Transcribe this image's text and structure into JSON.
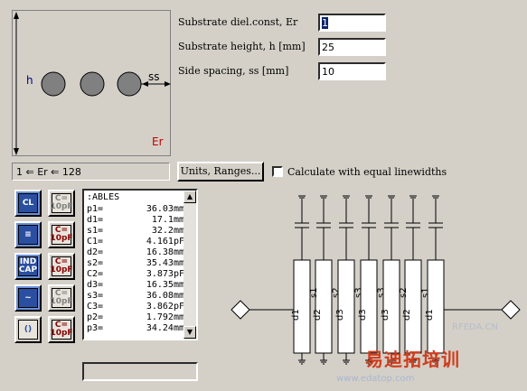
{
  "diagram": {
    "height_label": "h",
    "spacing_label": "ss",
    "er_label": "Er"
  },
  "params": [
    {
      "label": "Substrate diel.const, Er",
      "value": "1"
    },
    {
      "label": "Substrate height, h [mm]",
      "value": "25"
    },
    {
      "label": "Side spacing, ss [mm]",
      "value": "10"
    }
  ],
  "range_text": "1 ⇐ Er ⇐ 128",
  "units_button": "Units, Ranges...",
  "equal_linewidths_label": "Calculate with equal linewidths",
  "equal_linewidths_checked": false,
  "tools": [
    {
      "name": "coupled-lines-tool",
      "text": "CL"
    },
    {
      "name": "capacitor-tool-1",
      "text": "C=\n10pF"
    },
    {
      "name": "stepped-lines-tool",
      "text": "≡"
    },
    {
      "name": "capacitor-tool-2",
      "text": "C=\n10pF"
    },
    {
      "name": "ind-cap-tool",
      "text": "IND\nCAP"
    },
    {
      "name": "capacitor-tool-3",
      "text": "C=\n10pF"
    },
    {
      "name": "meander-tool",
      "text": "~"
    },
    {
      "name": "capacitor-tool-4",
      "text": "C=\n10pF"
    },
    {
      "name": "resonator-tool",
      "text": "()"
    },
    {
      "name": "capacitor-tool-5",
      "text": "C=\n10pF"
    }
  ],
  "results": {
    "header": ":ABLES",
    "rows": [
      {
        "k": "p1=",
        "v": "36.03mm"
      },
      {
        "k": "d1=",
        "v": "17.1mm"
      },
      {
        "k": "s1=",
        "v": "32.2mm"
      },
      {
        "k": "C1=",
        "v": "4.161pF"
      },
      {
        "k": "d2=",
        "v": "16.38mm"
      },
      {
        "k": "s2=",
        "v": "35.43mm"
      },
      {
        "k": "C2=",
        "v": "3.873pF"
      },
      {
        "k": "d3=",
        "v": "16.35mm"
      },
      {
        "k": "s3=",
        "v": "36.08mm"
      },
      {
        "k": "C3=",
        "v": "3.862pF"
      },
      {
        "k": "p2=",
        "v": "1.792mm"
      },
      {
        "k": "p3=",
        "v": "34.24mm"
      }
    ]
  },
  "schematic": {
    "d_labels": [
      "d1",
      "d2",
      "d3",
      "d3",
      "d3",
      "d2",
      "d1"
    ],
    "s_labels": [
      "s1",
      "s2",
      "s3",
      "s3",
      "s2",
      "s1"
    ]
  },
  "watermark": {
    "site1": "RFEDA.CN",
    "brand": "易迪拓培训",
    "site2": "www.edatop.com"
  }
}
